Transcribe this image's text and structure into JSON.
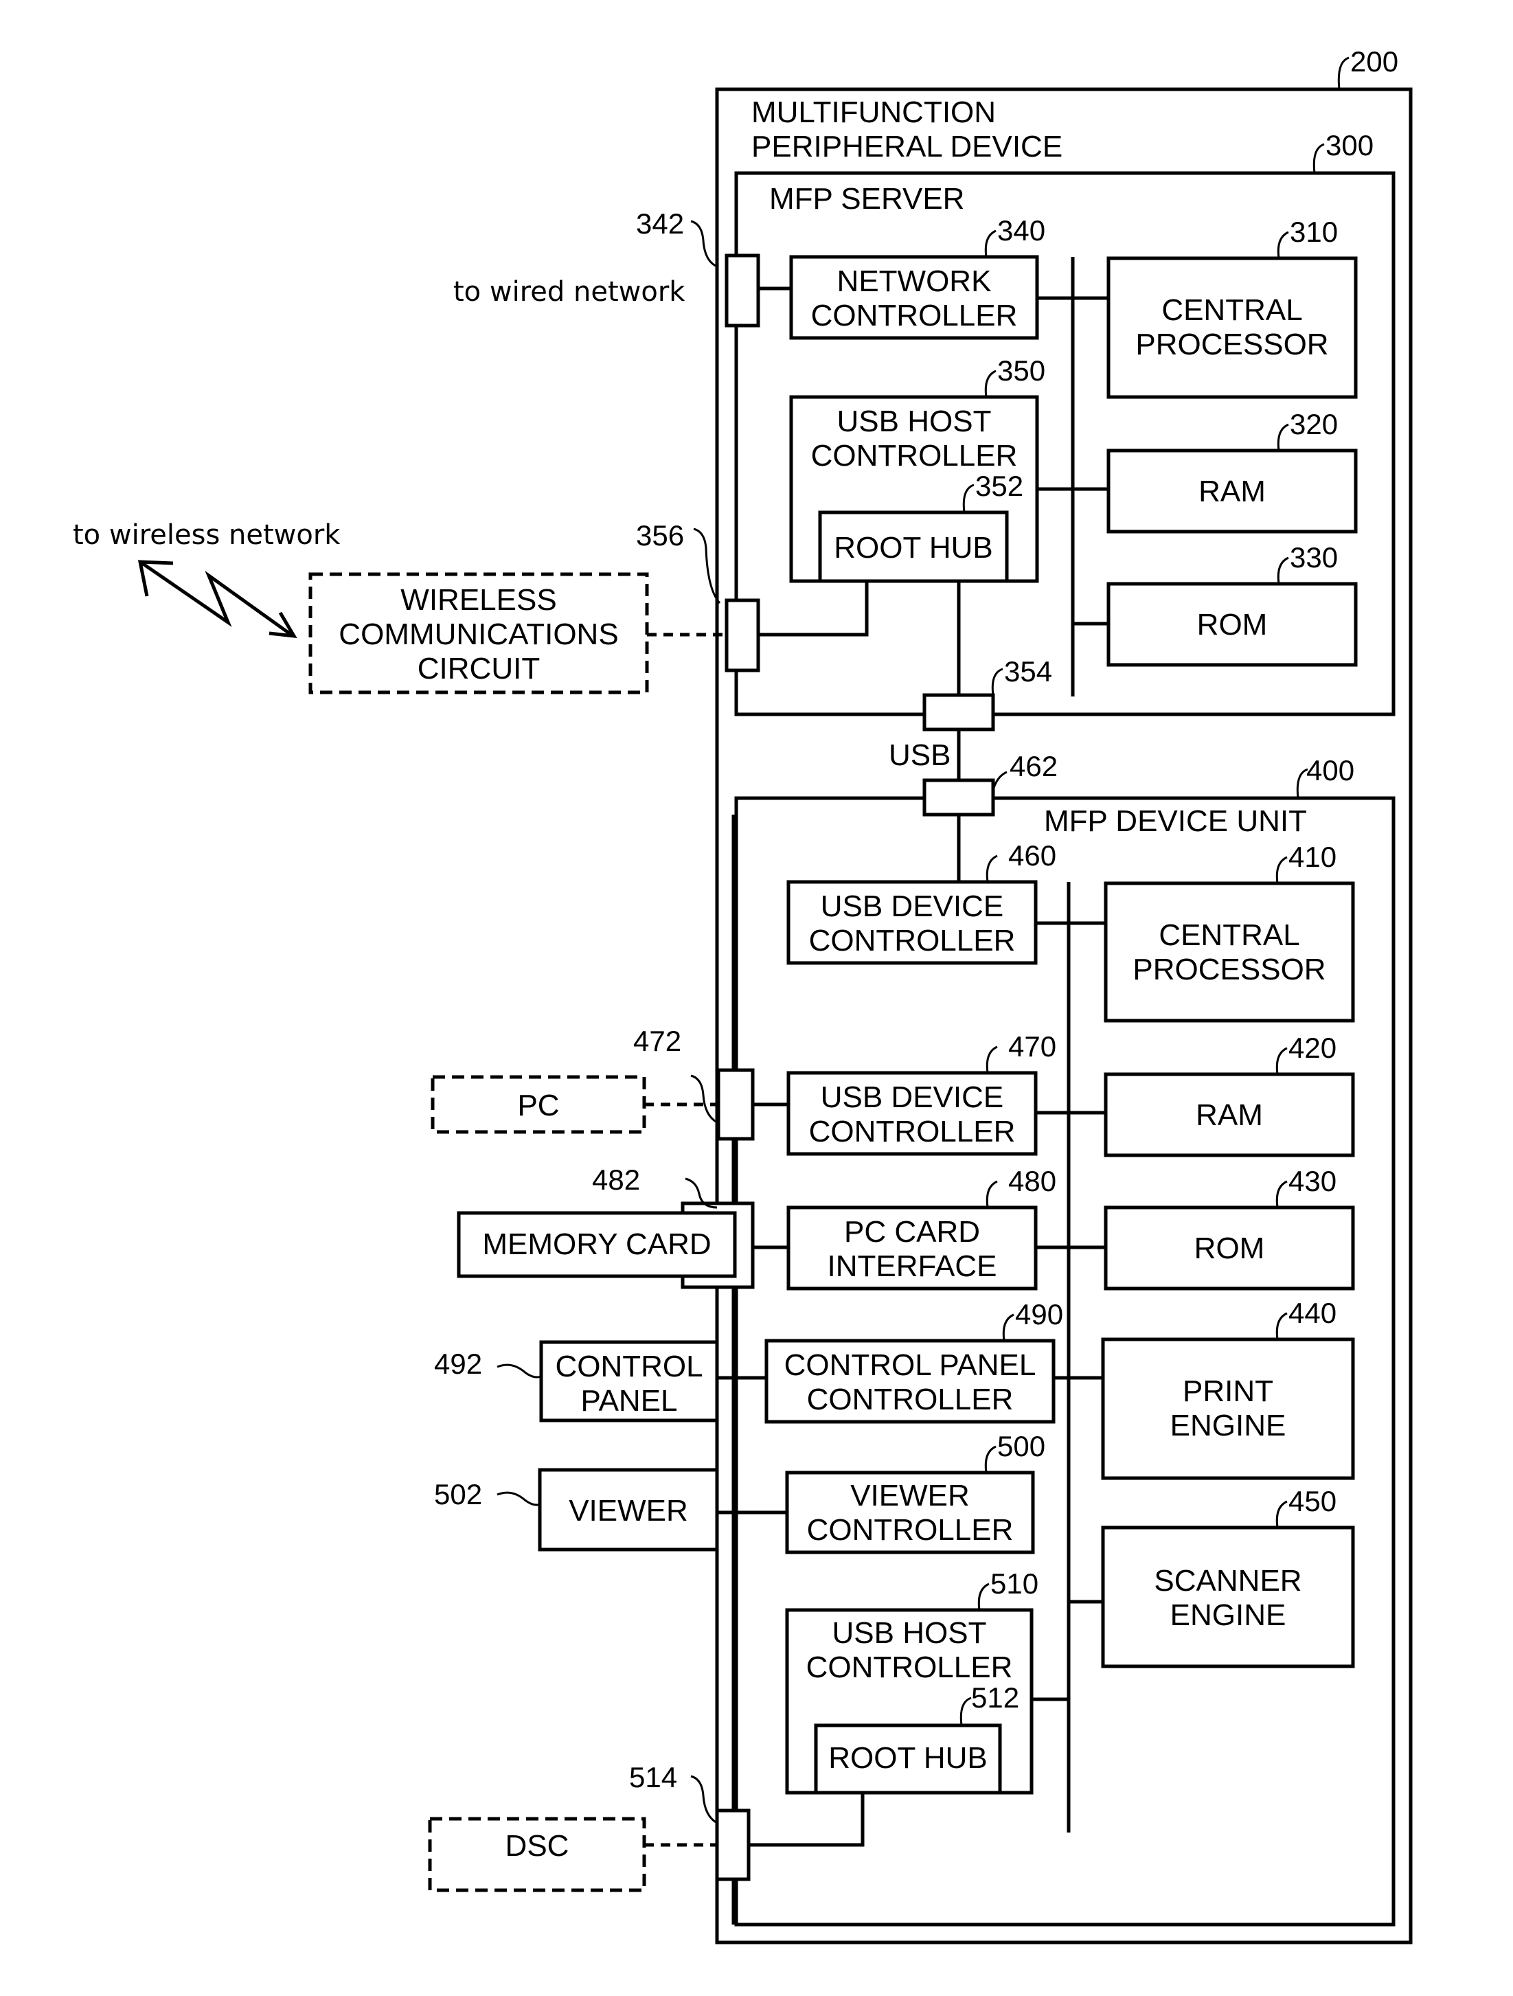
{
  "diagram": {
    "title_line1": "MULTIFUNCTION",
    "title_line2": "PERIPHERAL DEVICE",
    "refs": {
      "mfp": "200",
      "server": "300",
      "device_unit": "400"
    },
    "server": {
      "title": "MFP SERVER",
      "network_controller": {
        "ref": "340",
        "line1": "NETWORK",
        "line2": "CONTROLLER"
      },
      "central_processor": {
        "ref": "310",
        "line1": "CENTRAL",
        "line2": "PROCESSOR"
      },
      "usb_host_controller": {
        "ref": "350",
        "line1": "USB HOST",
        "line2": "CONTROLLER"
      },
      "root_hub": {
        "ref": "352",
        "label": "ROOT HUB"
      },
      "ram": {
        "ref": "320",
        "label": "RAM"
      },
      "rom": {
        "ref": "330",
        "label": "ROM"
      },
      "wired_port": {
        "ref": "342"
      },
      "wireless_port": {
        "ref": "356"
      },
      "usb_port": {
        "ref": "354"
      }
    },
    "usb_link_label": "USB",
    "device": {
      "title": "MFP DEVICE UNIT",
      "usb_port": {
        "ref": "462"
      },
      "usb_device_controller_1": {
        "ref": "460",
        "line1": "USB DEVICE",
        "line2": "CONTROLLER"
      },
      "central_processor": {
        "ref": "410",
        "line1": "CENTRAL",
        "line2": "PROCESSOR"
      },
      "usb_device_controller_2": {
        "ref": "470",
        "line1": "USB DEVICE",
        "line2": "CONTROLLER"
      },
      "ram": {
        "ref": "420",
        "label": "RAM"
      },
      "pc_card_interface": {
        "ref": "480",
        "line1": "PC CARD",
        "line2": "INTERFACE"
      },
      "rom": {
        "ref": "430",
        "label": "ROM"
      },
      "control_panel_controller": {
        "ref": "490",
        "line1": "CONTROL PANEL",
        "line2": "CONTROLLER"
      },
      "print_engine": {
        "ref": "440",
        "line1": "PRINT",
        "line2": "ENGINE"
      },
      "viewer_controller": {
        "ref": "500",
        "line1": "VIEWER",
        "line2": "CONTROLLER"
      },
      "scanner_engine": {
        "ref": "450",
        "line1": "SCANNER",
        "line2": "ENGINE"
      },
      "usb_host_controller": {
        "ref": "510",
        "line1": "USB HOST",
        "line2": "CONTROLLER"
      },
      "root_hub": {
        "ref": "512",
        "label": "ROOT HUB"
      },
      "pc_port": {
        "ref": "472"
      },
      "card_slot": {
        "ref": "482"
      },
      "dsc_port": {
        "ref": "514"
      }
    },
    "external": {
      "wired_network": "to wired network",
      "wireless_network": "to wireless network",
      "wireless_circuit": {
        "line1": "WIRELESS",
        "line2": "COMMUNICATIONS",
        "line3": "CIRCUIT"
      },
      "pc": "PC",
      "memory_card": "MEMORY CARD",
      "control_panel": {
        "ref": "492",
        "line1": "CONTROL",
        "line2": "PANEL"
      },
      "viewer": {
        "ref": "502",
        "label": "VIEWER"
      },
      "dsc": "DSC"
    }
  }
}
